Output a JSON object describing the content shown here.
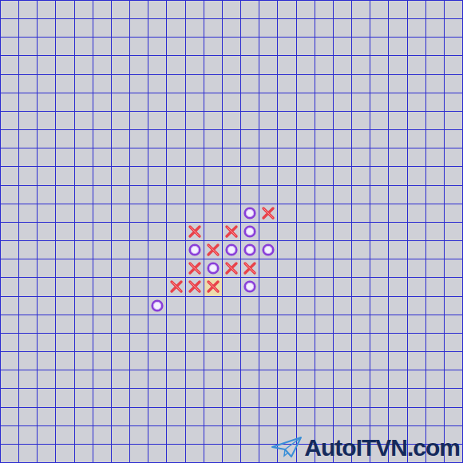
{
  "board": {
    "size": 25,
    "pieces": [
      {
        "row": 11,
        "col": 13,
        "kind": "o",
        "last": false
      },
      {
        "row": 11,
        "col": 14,
        "kind": "x",
        "last": false
      },
      {
        "row": 12,
        "col": 10,
        "kind": "x",
        "last": false
      },
      {
        "row": 12,
        "col": 12,
        "kind": "x",
        "last": false
      },
      {
        "row": 12,
        "col": 13,
        "kind": "o",
        "last": false
      },
      {
        "row": 13,
        "col": 10,
        "kind": "o",
        "last": false
      },
      {
        "row": 13,
        "col": 11,
        "kind": "x",
        "last": false
      },
      {
        "row": 13,
        "col": 12,
        "kind": "o",
        "last": false
      },
      {
        "row": 13,
        "col": 13,
        "kind": "o",
        "last": false
      },
      {
        "row": 13,
        "col": 14,
        "kind": "o",
        "last": false
      },
      {
        "row": 14,
        "col": 10,
        "kind": "x",
        "last": false
      },
      {
        "row": 14,
        "col": 11,
        "kind": "o",
        "last": false
      },
      {
        "row": 14,
        "col": 12,
        "kind": "x",
        "last": false
      },
      {
        "row": 14,
        "col": 13,
        "kind": "x",
        "last": false
      },
      {
        "row": 15,
        "col": 9,
        "kind": "x",
        "last": false
      },
      {
        "row": 15,
        "col": 10,
        "kind": "x",
        "last": false
      },
      {
        "row": 15,
        "col": 11,
        "kind": "x",
        "last": true
      },
      {
        "row": 15,
        "col": 13,
        "kind": "o",
        "last": false
      },
      {
        "row": 16,
        "col": 8,
        "kind": "o",
        "last": false
      }
    ]
  },
  "watermark": {
    "text": "AutoITVN.com"
  }
}
